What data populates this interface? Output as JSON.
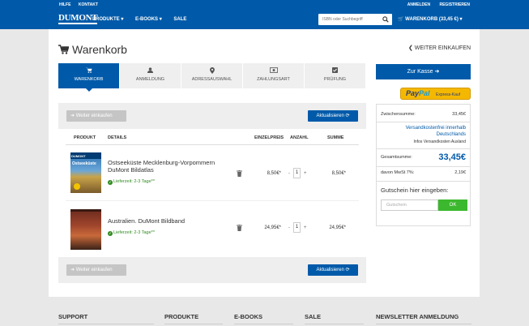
{
  "topbar": {
    "left": [
      "HILFE",
      "KONTAKT"
    ],
    "right": [
      "ANMELDEN",
      "REGISTRIEREN"
    ]
  },
  "header": {
    "logo": "DUMONT",
    "nav": [
      "PRODUKTE ▾",
      "E-BOOKS ▾",
      "SALE"
    ],
    "search_placeholder": "ISBN oder Suchbegriff",
    "cart": "WARENKORB (33,45 €) ▾"
  },
  "page": {
    "title": "Warenkorb",
    "continue_top": "WEITER EINKAUFEN"
  },
  "steps": [
    "WARENKORB",
    "ANMELDUNG",
    "ADRESSAUSWAHL",
    "ZAHLUNGSART",
    "PRÜFUNG"
  ],
  "actions": {
    "continue": "Weiter einkaufen",
    "update": "Aktualisieren"
  },
  "table": {
    "headers": [
      "PRODUKT",
      "DETAILS",
      "EINZELPREIS",
      "ANZAHL",
      "SUMME"
    ],
    "rows": [
      {
        "title": "Ostseeküste Mecklenburg-Vorpommern DuMont Bildatlas",
        "delivery": "Lieferzeit: 2-3 Tage**",
        "price": "8,50€*",
        "qty": "1",
        "sum": "8,50€*",
        "cover_label": "DUMONT",
        "cover_sub": "Ostseeküste"
      },
      {
        "title": "Australien. DuMont Bildband",
        "delivery": "Lieferzeit: 2-3 Tage**",
        "price": "24,95€*",
        "qty": "1",
        "sum": "24,95€*",
        "cover_label": "",
        "cover_sub": ""
      }
    ]
  },
  "sidebar": {
    "checkout": "Zur Kasse",
    "paypal_pay": "Pay",
    "paypal_pal": "Pal",
    "paypal_express": "Express-Kauf",
    "subtotal_label": "Zwischensumme:",
    "subtotal": "33,45€",
    "shipping_line1": "Versandkostenfrei innerhalb",
    "shipping_line2": "Deutschlands",
    "shipping_note": "Infos Versandkosten Ausland",
    "total_label": "Gesamtsumme:",
    "total": "33,45€",
    "vat_label": "davon MwSt 7%:",
    "vat": "2,19€",
    "voucher_label": "Gutschein hier eingeben:",
    "voucher_placeholder": "Gutschein",
    "voucher_ok": "OK"
  },
  "footer": [
    "SUPPORT",
    "PRODUKTE",
    "E-BOOKS",
    "SALE",
    "NEWSLETTER ANMELDUNG"
  ],
  "colors": {
    "brand": "#005aa9",
    "success": "#3cb82e",
    "paypal": "#f5b800"
  }
}
